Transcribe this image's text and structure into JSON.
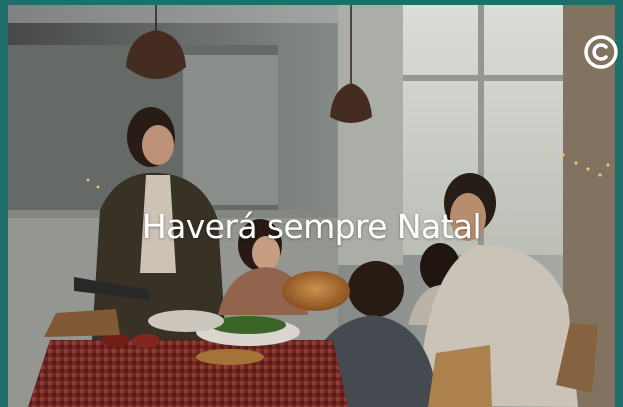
{
  "video": {
    "caption": "Haverá sempre Natal",
    "brand_logo_icon": "c-circle-logo-icon",
    "border_color": "#1f6e6c"
  }
}
